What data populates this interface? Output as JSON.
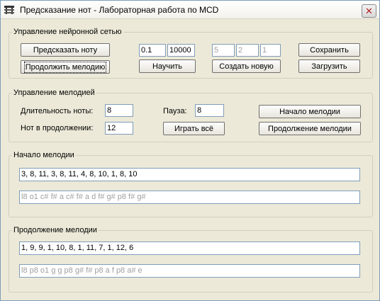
{
  "window": {
    "title": "Предсказание нот - Лабораторная работа по MCD",
    "icon": "app-icon",
    "close_label": "✕"
  },
  "neural": {
    "title": "Управление нейронной сетью",
    "predict_label": "Предсказать ноту",
    "continue_label": "Продолжить мелодию",
    "train_label": "Научить",
    "create_label": "Создать новую",
    "save_label": "Сохранить",
    "load_label": "Загрузить",
    "learning_rate": "0.1",
    "iterations": "10000",
    "layer1": "5",
    "layer2": "2",
    "layer3": "1"
  },
  "melody": {
    "title": "Управление мелодией",
    "duration_label": "Длительность ноты:",
    "duration_value": "8",
    "pause_label": "Пауза:",
    "pause_value": "8",
    "count_label": "Нот в продолжении:",
    "count_value": "12",
    "play_all_label": "Играть всё",
    "start_btn_label": "Начало мелодии",
    "cont_btn_label": "Продолжение мелодии"
  },
  "start": {
    "title": "Начало мелодии",
    "numbers": "3, 8, 11, 3, 8, 11, 4, 8, 10, 1, 8, 10",
    "notes": "l8 o1 c# f# a c# f# a d f# g# p8 f# g#"
  },
  "continuation": {
    "title": "Продолжение мелодии",
    "numbers": "1, 9, 9, 1, 10, 8, 1, 11, 7, 1, 12, 6",
    "notes": "l8  p8 o1 g g p8 g# f# p8 a f p8 a# e"
  }
}
